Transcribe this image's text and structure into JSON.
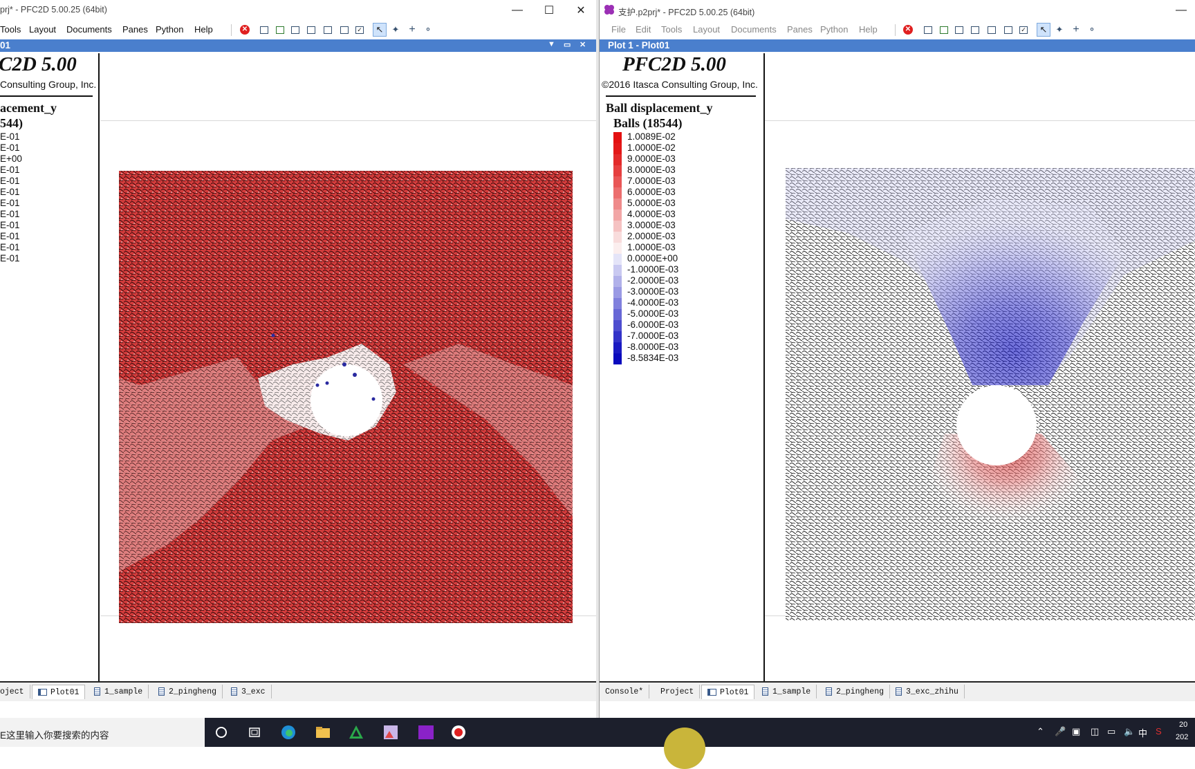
{
  "left_window": {
    "title": "prj* - PFC2D 5.00.25 (64bit)",
    "menus": [
      "Tools",
      "Layout",
      "Documents",
      "Panes",
      "Python",
      "Help"
    ],
    "pane_title": "01",
    "legend": {
      "logo": "C2D 5.00",
      "copyright": "Consulting Group, Inc.",
      "variable": "acement_y",
      "subtitle": "544)",
      "values": [
        "E-01",
        "E-01",
        "E+00",
        "E-01",
        "E-01",
        "E-01",
        "E-01",
        "E-01",
        "E-01",
        "E-01",
        "E-01",
        "E-01"
      ],
      "colors": [
        "#ffffff",
        "#ffffff",
        "#ffffff",
        "#ffffff",
        "#ffffff",
        "#ffffff",
        "#ffffff",
        "#ffffff",
        "#ffffff",
        "#ffffff",
        "#ffffff",
        "#ffffff"
      ]
    },
    "tabs": [
      "oject",
      "Plot01",
      "1_sample",
      "2_pingheng",
      "3_exc"
    ],
    "active_tab": "Plot01"
  },
  "right_window": {
    "title": "支护.p2prj* - PFC2D 5.00.25 (64bit)",
    "menus": [
      "File",
      "Edit",
      "Tools",
      "Layout",
      "Documents",
      "Panes",
      "Python",
      "Help"
    ],
    "pane_title": "Plot 1 - Plot01",
    "legend": {
      "logo": "PFC2D 5.00",
      "copyright": "©2016 Itasca Consulting Group, Inc.",
      "variable": "Ball displacement_y",
      "subtitle": "Balls (18544)",
      "values": [
        "1.0089E-02",
        "1.0000E-02",
        "9.0000E-03",
        "8.0000E-03",
        "7.0000E-03",
        "6.0000E-03",
        "5.0000E-03",
        "4.0000E-03",
        "3.0000E-03",
        "2.0000E-03",
        "1.0000E-03",
        "0.0000E+00",
        "-1.0000E-03",
        "-2.0000E-03",
        "-3.0000E-03",
        "-4.0000E-03",
        "-5.0000E-03",
        "-6.0000E-03",
        "-7.0000E-03",
        "-8.0000E-03",
        "-8.5834E-03"
      ],
      "colors": [
        "#e31010",
        "#e31818",
        "#e32a2a",
        "#e63f3f",
        "#e95656",
        "#ec6e6e",
        "#ef8a8a",
        "#f2a6a6",
        "#f5c2c2",
        "#f8dcdc",
        "#fbeeee",
        "#e4e4f8",
        "#c9c9f1",
        "#b1b1ea",
        "#9a9ae4",
        "#8080dd",
        "#6767d6",
        "#4d4dcf",
        "#3333c8",
        "#1a1ac2",
        "#0a0abd"
      ]
    },
    "tabs": [
      "Console*",
      "Project",
      "Plot01",
      "1_sample",
      "2_pingheng",
      "3_exc_zhihu"
    ],
    "active_tab": "Plot01"
  },
  "taskbar": {
    "search_placeholder": "E这里输入你要搜索的内容",
    "ime": "中",
    "clock": "20",
    "date": "202"
  },
  "colors": {
    "accent": "#4a7fcd",
    "ball_red": "#d23a3a",
    "ball_blue": "#3a3ad8"
  }
}
